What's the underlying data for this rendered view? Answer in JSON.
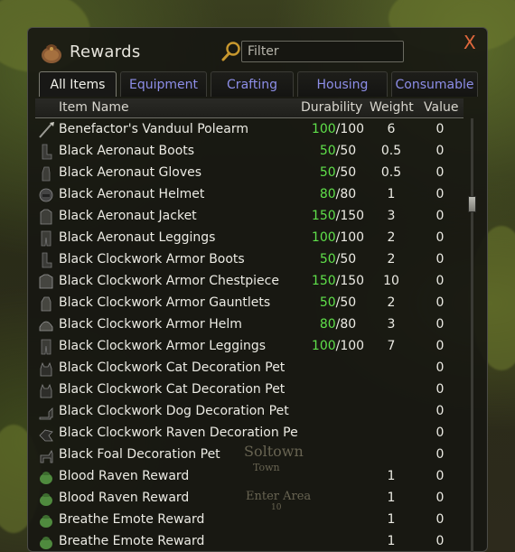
{
  "window": {
    "title": "Rewards",
    "close_glyph": "X",
    "bag_icon": "loot-bag-icon",
    "search_icon": "magnifier-icon"
  },
  "filter": {
    "placeholder": "Filter"
  },
  "tabs": [
    {
      "label": "All Items",
      "active": true
    },
    {
      "label": "Equipment",
      "active": false
    },
    {
      "label": "Crafting",
      "active": false
    },
    {
      "label": "Housing",
      "active": false
    },
    {
      "label": "Consumable",
      "active": false
    }
  ],
  "columns": {
    "name": "Item Name",
    "durability": "Durability",
    "weight": "Weight",
    "value": "Value"
  },
  "items": [
    {
      "icon": "polearm-icon",
      "name": "Benefactor's Vanduul Polearm",
      "dur_cur": "100",
      "dur_max": "/100",
      "weight": "6",
      "value": "0"
    },
    {
      "icon": "boots-icon",
      "name": "Black Aeronaut Boots",
      "dur_cur": "50",
      "dur_max": "/50",
      "weight": "0.5",
      "value": "0"
    },
    {
      "icon": "gloves-icon",
      "name": "Black Aeronaut Gloves",
      "dur_cur": "50",
      "dur_max": "/50",
      "weight": "0.5",
      "value": "0"
    },
    {
      "icon": "helmet-icon",
      "name": "Black Aeronaut Helmet",
      "dur_cur": "80",
      "dur_max": "/80",
      "weight": "1",
      "value": "0"
    },
    {
      "icon": "jacket-icon",
      "name": "Black Aeronaut Jacket",
      "dur_cur": "150",
      "dur_max": "/150",
      "weight": "3",
      "value": "0"
    },
    {
      "icon": "leggings-icon",
      "name": "Black Aeronaut Leggings",
      "dur_cur": "100",
      "dur_max": "/100",
      "weight": "2",
      "value": "0"
    },
    {
      "icon": "boots-icon",
      "name": "Black Clockwork Armor Boots",
      "dur_cur": "50",
      "dur_max": "/50",
      "weight": "2",
      "value": "0"
    },
    {
      "icon": "chestpiece-icon",
      "name": "Black Clockwork Armor Chestpiece",
      "dur_cur": "150",
      "dur_max": "/150",
      "weight": "10",
      "value": "0"
    },
    {
      "icon": "gauntlets-icon",
      "name": "Black Clockwork Armor Gauntlets",
      "dur_cur": "50",
      "dur_max": "/50",
      "weight": "2",
      "value": "0"
    },
    {
      "icon": "helm-icon",
      "name": "Black Clockwork Armor Helm",
      "dur_cur": "80",
      "dur_max": "/80",
      "weight": "3",
      "value": "0"
    },
    {
      "icon": "leggings-icon",
      "name": "Black Clockwork Armor Leggings",
      "dur_cur": "100",
      "dur_max": "/100",
      "weight": "7",
      "value": "0"
    },
    {
      "icon": "cat-icon",
      "name": "Black Clockwork Cat Decoration Pet",
      "dur_cur": "",
      "dur_max": "",
      "weight": "",
      "value": "0"
    },
    {
      "icon": "cat-icon",
      "name": "Black Clockwork Cat Decoration Pet",
      "dur_cur": "",
      "dur_max": "",
      "weight": "",
      "value": "0"
    },
    {
      "icon": "dog-icon",
      "name": "Black Clockwork Dog Decoration Pet",
      "dur_cur": "",
      "dur_max": "",
      "weight": "",
      "value": "0"
    },
    {
      "icon": "raven-icon",
      "name": "Black Clockwork Raven Decoration Pe",
      "dur_cur": "",
      "dur_max": "",
      "weight": "",
      "value": "0"
    },
    {
      "icon": "foal-icon",
      "name": "Black Foal Decoration Pet",
      "dur_cur": "",
      "dur_max": "",
      "weight": "",
      "value": "0"
    },
    {
      "icon": "reward-bag-icon",
      "name": "Blood Raven Reward",
      "dur_cur": "",
      "dur_max": "",
      "weight": "1",
      "value": "0"
    },
    {
      "icon": "reward-bag-icon",
      "name": "Blood Raven Reward",
      "dur_cur": "",
      "dur_max": "",
      "weight": "1",
      "value": "0"
    },
    {
      "icon": "reward-bag-icon",
      "name": "Breathe Emote Reward",
      "dur_cur": "",
      "dur_max": "",
      "weight": "1",
      "value": "0"
    },
    {
      "icon": "reward-bag-icon",
      "name": "Breathe Emote Reward",
      "dur_cur": "",
      "dur_max": "",
      "weight": "1",
      "value": "0"
    }
  ],
  "background": {
    "town_name": "Soltown",
    "town_type": "Town",
    "enter_label": "Enter Area",
    "enter_sub": "10"
  },
  "colors": {
    "close": "#e0683c",
    "tab_inactive": "#8d8ee8",
    "durability_current": "#5fe04a",
    "text": "#ecebe4"
  }
}
